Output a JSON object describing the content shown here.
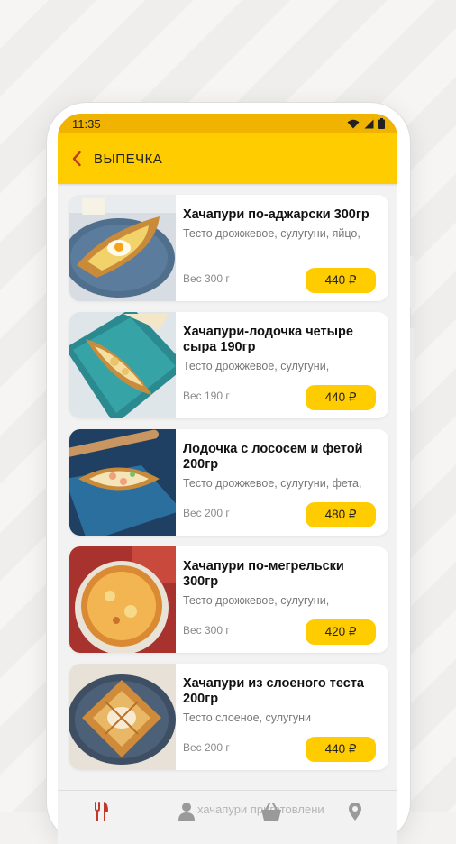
{
  "status_bar": {
    "time": "11:35"
  },
  "header": {
    "title": "ВЫПЕЧКА"
  },
  "products": [
    {
      "name": "Хачапури по-аджарски 300гр",
      "description": "Тесто дрожжевое, сулугуни, яйцо,",
      "weight": "Вес 300 г",
      "price": "440 ₽"
    },
    {
      "name": "Хачапури-лодочка четыре сыра 190гр",
      "description": "Тесто дрожжевое, сулугуни,",
      "weight": "Вес 190 г",
      "price": "440 ₽"
    },
    {
      "name": "Лодочка с лососем и фетой 200гр",
      "description": "Тесто дрожжевое, сулугуни, фета,",
      "weight": "Вес 200 г",
      "price": "480 ₽"
    },
    {
      "name": "Хачапури по-мегрельски 300гр",
      "description": "Тесто дрожжевое, сулугуни,",
      "weight": "Вес 300 г",
      "price": "420 ₽"
    },
    {
      "name": "Хачапури из слоеного теста 200гр",
      "description": "Тесто слоеное, сулугуни",
      "weight": "Вес 200 г",
      "price": "440 ₽"
    }
  ],
  "bottom_nav": {
    "label": "хачапури приготовлени"
  },
  "icons": {
    "back": "chevron-left-icon",
    "menu": "fork-knife-icon",
    "profile": "person-icon",
    "cart": "basket-icon",
    "location": "location-pin-icon"
  },
  "colors": {
    "header": "#ffcc00",
    "status_bar": "#f0b400",
    "price_button": "#ffcc00",
    "back_arrow": "#c0392b"
  }
}
